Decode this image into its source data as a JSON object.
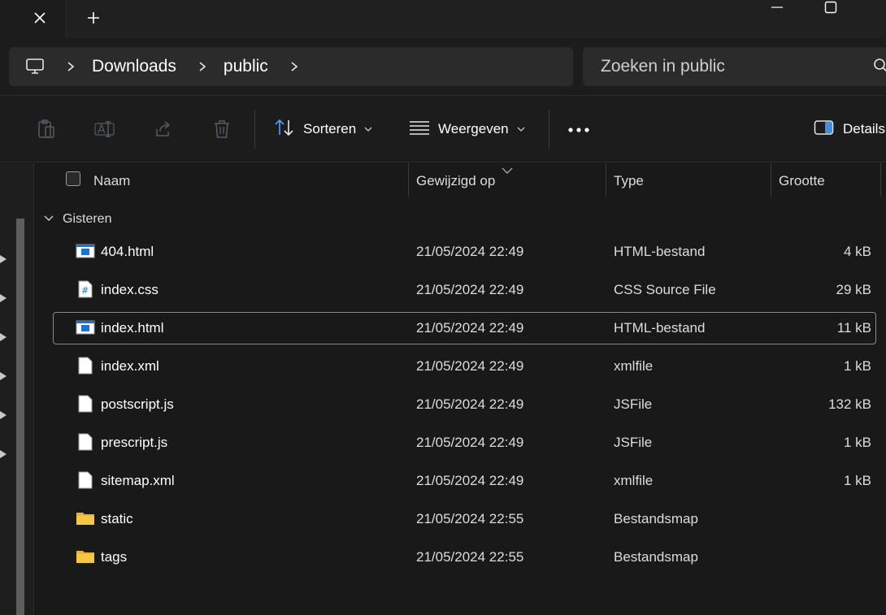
{
  "titlebar": {
    "close_tab_icon": "close-icon",
    "new_tab_icon": "plus-icon"
  },
  "address": {
    "crumbs": [
      "Downloads",
      "public"
    ],
    "search_placeholder": "Zoeken in public"
  },
  "toolbar": {
    "sort_label": "Sorteren",
    "view_label": "Weergeven",
    "details_label": "Details"
  },
  "columns": {
    "name": "Naam",
    "modified": "Gewijzigd op",
    "type": "Type",
    "size": "Grootte"
  },
  "group_label": "Gisteren",
  "files": [
    {
      "name": "404.html",
      "modified": "21/05/2024 22:49",
      "type": "HTML-bestand",
      "size": "4 kB",
      "icon": "html"
    },
    {
      "name": "index.css",
      "modified": "21/05/2024 22:49",
      "type": "CSS Source File",
      "size": "29 kB",
      "icon": "css"
    },
    {
      "name": "index.html",
      "modified": "21/05/2024 22:49",
      "type": "HTML-bestand",
      "size": "11 kB",
      "icon": "html"
    },
    {
      "name": "index.xml",
      "modified": "21/05/2024 22:49",
      "type": "xmlfile",
      "size": "1 kB",
      "icon": "file"
    },
    {
      "name": "postscript.js",
      "modified": "21/05/2024 22:49",
      "type": "JSFile",
      "size": "132 kB",
      "icon": "file"
    },
    {
      "name": "prescript.js",
      "modified": "21/05/2024 22:49",
      "type": "JSFile",
      "size": "1 kB",
      "icon": "file"
    },
    {
      "name": "sitemap.xml",
      "modified": "21/05/2024 22:49",
      "type": "xmlfile",
      "size": "1 kB",
      "icon": "file"
    },
    {
      "name": "static",
      "modified": "21/05/2024 22:55",
      "type": "Bestandsmap",
      "size": "",
      "icon": "folder"
    },
    {
      "name": "tags",
      "modified": "21/05/2024 22:55",
      "type": "Bestandsmap",
      "size": "",
      "icon": "folder"
    }
  ],
  "colors": {
    "background": "#191919",
    "folder": "#f6c744",
    "html_icon_blue": "#1a73d9",
    "accent_blue": "#4aa3ff"
  }
}
